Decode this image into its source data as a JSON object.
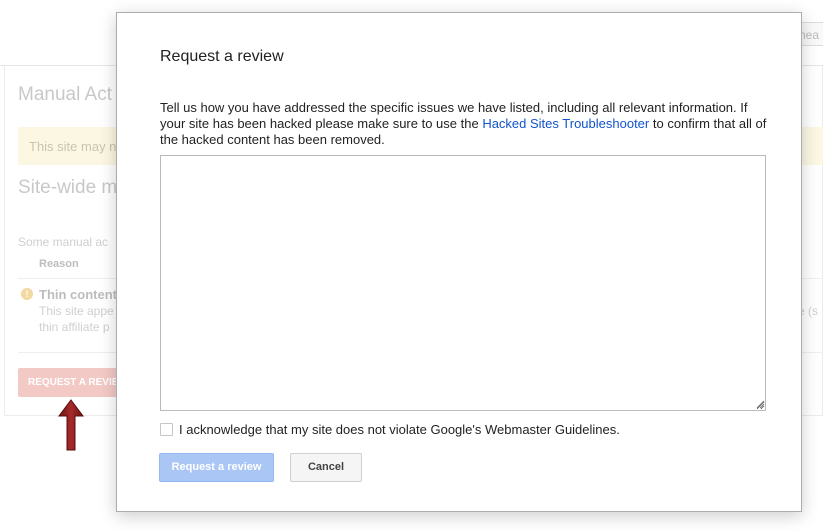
{
  "background": {
    "topright_fragment": "hea",
    "title": "Manual Act",
    "banner_text": "This site may n",
    "subtitle": "Site-wide m",
    "some_text": "Some manual ac",
    "reason_header": "Reason",
    "issue_title": "Thin content",
    "issue_line1": "This site appe",
    "issue_line2": "thin affiliate p",
    "right_fragment": "e (s",
    "request_button_label": "REQUEST A REVIE"
  },
  "modal": {
    "title": "Request a review",
    "description_before_link": "Tell us how you have addressed the specific issues we have listed, including all relevant information. If your site has been hacked please make sure to use the ",
    "link_text": "Hacked Sites Troubleshooter",
    "description_after_link": " to confirm that all of the hacked content has been removed.",
    "textarea_value": "",
    "acknowledge_label": "I acknowledge that my site does not violate Google's Webmaster Guidelines.",
    "acknowledge_checked": false,
    "submit_label": "Request a review",
    "cancel_label": "Cancel"
  },
  "colors": {
    "link": "#1155cc",
    "primary_button_disabled": "#a9c6f5",
    "arrow": "#8b1a1a"
  }
}
